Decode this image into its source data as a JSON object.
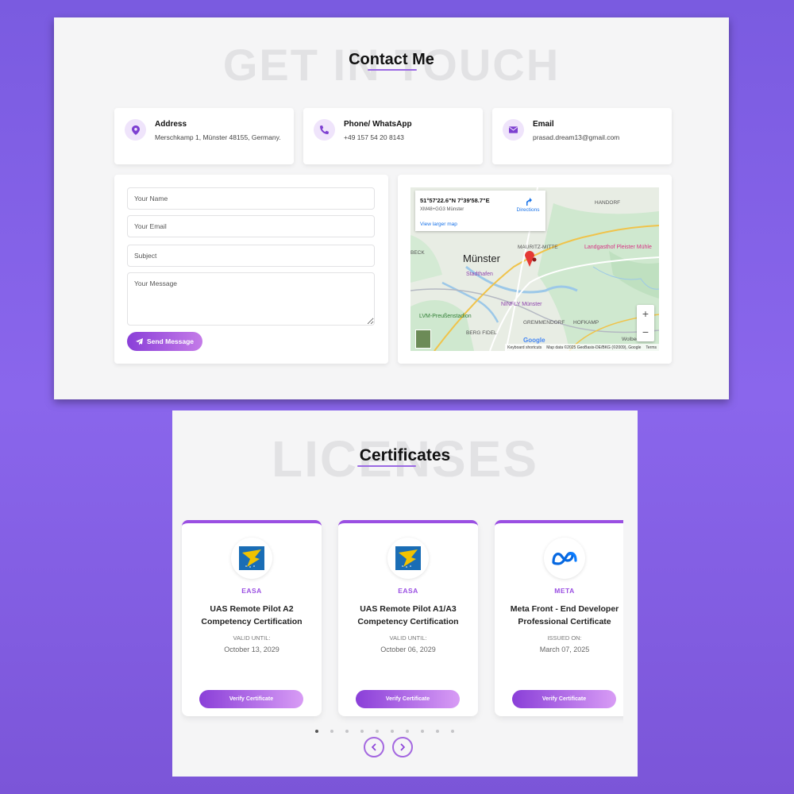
{
  "contact": {
    "bg_title": "GET IN TOUCH",
    "title": "Contact Me",
    "cards": [
      {
        "title": "Address",
        "text": "Merschkamp 1, Münster 48155, Germany.",
        "icon": "location-pin-icon"
      },
      {
        "title": "Phone/ WhatsApp",
        "text": "+49 157 54 20 8143",
        "icon": "phone-icon"
      },
      {
        "title": "Email",
        "text": "prasad.dream13@gmail.com",
        "icon": "envelope-icon"
      }
    ],
    "form": {
      "name_placeholder": "Your Name",
      "email_placeholder": "Your Email",
      "subject_placeholder": "Subject",
      "message_placeholder": "Your Message",
      "send_label": "Send Message"
    },
    "map": {
      "coords": "51°57'22.6\"N 7°39'58.7\"E",
      "plus_code": "XM48+GG3 Münster",
      "directions_label": "Directions",
      "larger_map_label": "View larger map",
      "city": "Münster",
      "labels": [
        "HANDORF",
        "MAURITZ-MITTE",
        "GREMMENDORF",
        "HOFKAMP",
        "BERG FIDEL",
        "BECK",
        "Wolbeck"
      ],
      "pois": [
        "Landgasthof Pleister Mühle",
        "Stadthafen",
        "NINFLY Münster",
        "LVM-Preußenstadion"
      ],
      "google": "Google",
      "footer": [
        "Keyboard shortcuts",
        "Map data ©2025 GeoBasis-DE/BKG (©2009), Google",
        "Terms"
      ],
      "zoom_in": "+",
      "zoom_out": "−"
    }
  },
  "certificates": {
    "bg_title": "LICENSES",
    "title": "Certificates",
    "items": [
      {
        "issuer": "EASA",
        "name": "UAS Remote Pilot A2 Competency Certification",
        "date_label": "VALID UNTIL:",
        "date": "October 13, 2029",
        "button": "Verify Certificate",
        "logo": "easa-logo-icon"
      },
      {
        "issuer": "EASA",
        "name": "UAS Remote Pilot A1/A3 Competency Certification",
        "date_label": "VALID UNTIL:",
        "date": "October 06, 2029",
        "button": "Verify Certificate",
        "logo": "easa-logo-icon"
      },
      {
        "issuer": "META",
        "name": "Meta Front - End Developer Professional Certificate",
        "date_label": "ISSUED ON:",
        "date": "March 07, 2025",
        "button": "Verify Certificate",
        "logo": "meta-logo-icon"
      }
    ],
    "pagination": {
      "total": 10,
      "active": 0
    },
    "prev_icon": "chevron-left-icon",
    "next_icon": "chevron-right-icon"
  },
  "colors": {
    "accent": "#9a4fe2",
    "background": "#7f5ce6",
    "panel": "#f5f5f6"
  }
}
